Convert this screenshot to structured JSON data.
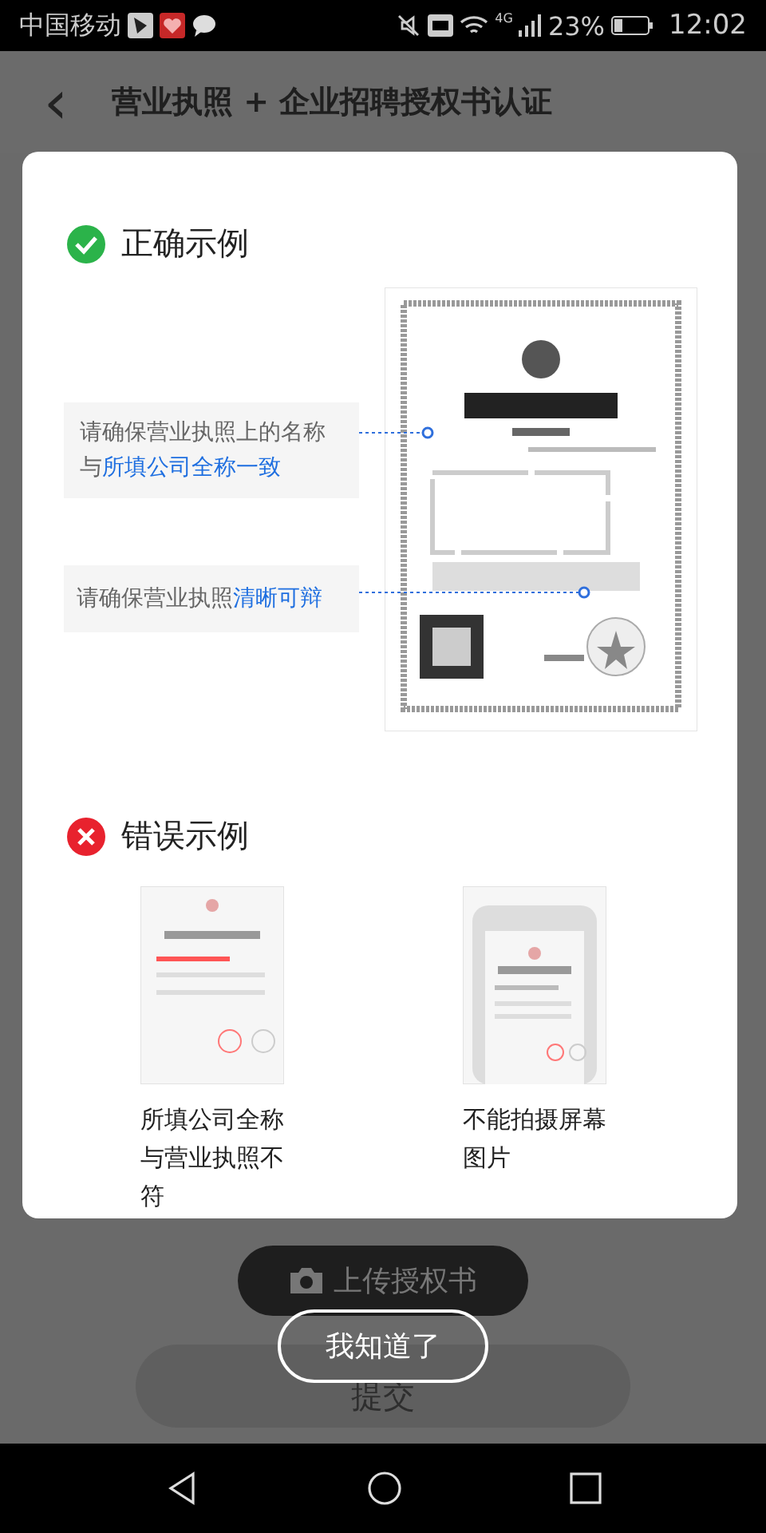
{
  "status_bar": {
    "carrier": "中国移动",
    "network": "4G",
    "battery": "23%",
    "time": "12:02"
  },
  "header": {
    "back": "‹",
    "title": "营业执照 + 企业招聘授权书认证"
  },
  "background_buttons": [
    {
      "kind": "upload",
      "label": "上传授权书"
    },
    {
      "kind": "submit",
      "label": "提交"
    }
  ],
  "dialog": {
    "correct": {
      "title": "正确示例",
      "callouts": [
        {
          "text": "请确保营业执照上的名称与",
          "highlight": "所填公司全称一致"
        },
        {
          "text": "请确保营业执照",
          "highlight": "清晰可辩"
        }
      ]
    },
    "wrong": {
      "title": "错误示例",
      "examples": [
        {
          "caption": "所填公司全称与营业执照不符"
        },
        {
          "caption": "不能拍摄屏幕图片"
        }
      ]
    }
  },
  "confirm_button": "我知道了"
}
